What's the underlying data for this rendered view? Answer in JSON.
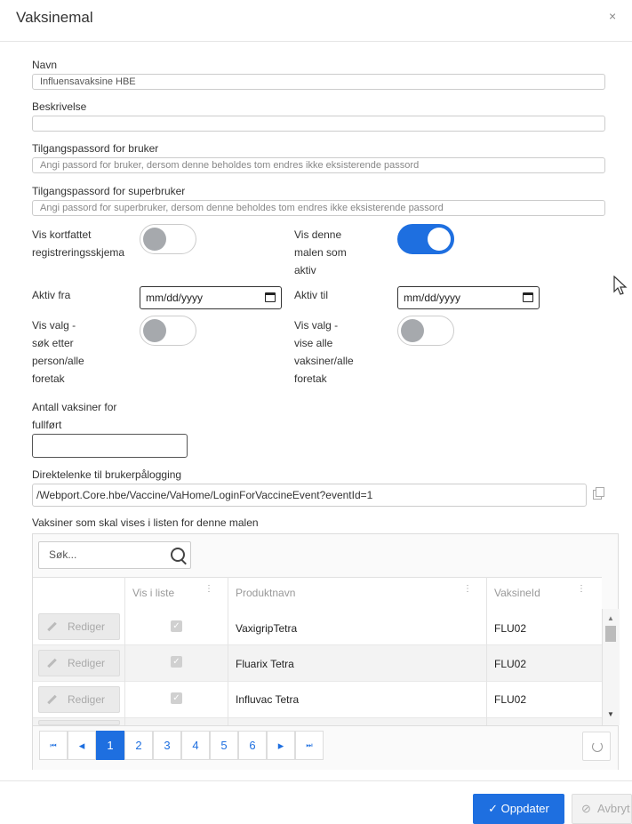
{
  "modal": {
    "title": "Vaksinemal",
    "close_symbol": "×"
  },
  "form": {
    "name": {
      "label": "Navn",
      "value": "Influensavaksine HBE"
    },
    "description": {
      "label": "Beskrivelse",
      "value": ""
    },
    "user_password": {
      "label": "Tilgangspassord for bruker",
      "placeholder": "Angi passord for bruker, dersom denne beholdes tom endres ikke eksisterende passord"
    },
    "superuser_password": {
      "label": "Tilgangspassord for superbruker",
      "placeholder": "Angi passord for superbruker, dersom denne beholdes tom endres ikke eksisterende passord"
    },
    "short_form": {
      "label_lines": [
        "Vis kortfattet",
        "registreringsskjema"
      ],
      "on": false
    },
    "show_active": {
      "label_lines": [
        "Vis denne",
        "malen som",
        "aktiv"
      ],
      "on": true
    },
    "active_from": {
      "label": "Aktiv fra",
      "value": "mm/dd/yyyy"
    },
    "active_to": {
      "label": "Aktiv til",
      "value": "mm/dd/yyyy"
    },
    "search_person": {
      "label_lines": [
        "Vis valg -",
        "søk etter",
        "person/alle",
        "foretak"
      ],
      "on": false
    },
    "show_all_vaccines": {
      "label_lines": [
        "Vis valg -",
        "vise alle",
        "vaksiner/alle",
        "foretak"
      ],
      "on": false
    },
    "vaccine_count": {
      "label_lines": [
        "Antall vaksiner for",
        "fullført"
      ],
      "value": ""
    },
    "direct_link": {
      "label": "Direktelenke til brukerpålogging",
      "value": "/Webport.Core.hbe/Vaccine/VaHome/LoginForVaccineEvent?eventId=1"
    }
  },
  "grid": {
    "title": "Vaksiner som skal vises i listen for denne malen",
    "search_placeholder": "Søk...",
    "columns": [
      "Vis i liste",
      "Produktnavn",
      "VaksineId"
    ],
    "edit_label": "Rediger",
    "check_symbol": "✓",
    "rows": [
      {
        "product": "VaxigripTetra",
        "vaccine_id": "FLU02",
        "show": true
      },
      {
        "product": "Fluarix Tetra",
        "vaccine_id": "FLU02",
        "show": true
      },
      {
        "product": "Influvac Tetra",
        "vaccine_id": "FLU02",
        "show": true
      }
    ],
    "pager": {
      "first": "⏮",
      "prev": "◂",
      "next": "▸",
      "last": "⏭",
      "pages": [
        "1",
        "2",
        "3",
        "4",
        "5",
        "6"
      ],
      "current": "1"
    }
  },
  "footer": {
    "update_label": "Oppdater",
    "update_icon": "✓",
    "cancel_label": "Avbryt",
    "cancel_icon": "⊘"
  },
  "colors": {
    "primary": "#1e6fe0"
  }
}
